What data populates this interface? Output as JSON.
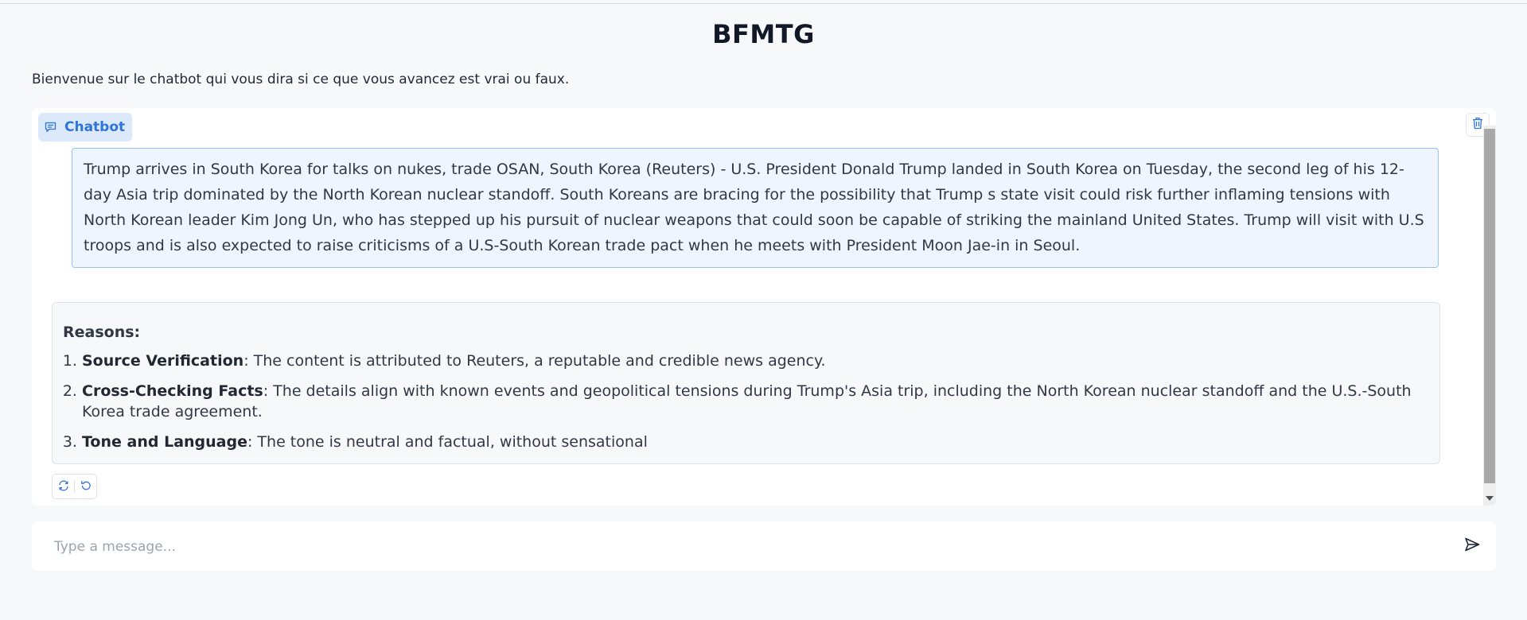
{
  "app": {
    "title": "BFMTG",
    "subtitle": "Bienvenue sur le chatbot qui vous dira si ce que vous avancez est vrai ou faux."
  },
  "chatbot": {
    "label": "Chatbot",
    "label_icon": "chat-icon",
    "delete_icon": "trash-icon",
    "user_message": "Trump arrives in South Korea for talks on nukes, trade OSAN, South Korea (Reuters) - U.S. President Donald Trump landed in South Korea on Tuesday, the second leg of his 12-day Asia trip dominated by the North Korean nuclear standoff. South Koreans are bracing for the possibility that Trump s state visit could risk further inflaming tensions with North Korean leader Kim Jong Un, who has stepped up his pursuit of nuclear weapons that could soon be capable of striking the mainland United States. Trump will visit with U.S troops and is also expected to raise criticisms of a U.S-South Korean trade pact when he meets with President Moon Jae-in in Seoul.",
    "bot_message": {
      "heading": "Reasons:",
      "items": [
        {
          "title": "Source Verification",
          "text": ": The content is attributed to Reuters, a reputable and credible news agency."
        },
        {
          "title": "Cross-Checking Facts",
          "text": ": The details align with known events and geopolitical tensions during Trump's Asia trip, including the North Korean nuclear standoff and the U.S.-South Korea trade agreement."
        },
        {
          "title": "Tone and Language",
          "text": ": The tone is neutral and factual, without sensational"
        }
      ]
    },
    "actions": [
      {
        "icon": "retry-icon"
      },
      {
        "icon": "undo-icon"
      }
    ]
  },
  "input": {
    "placeholder": "Type a message...",
    "value": "",
    "send_icon": "send-icon"
  },
  "colors": {
    "accent": "#2f74d8",
    "label_bg": "#dbe9fb",
    "user_bubble_bg": "#eef5fe",
    "user_bubble_border": "#98c3f1",
    "bot_bubble_bg": "#f7f8fa",
    "page_bg": "#f7f8fa"
  }
}
